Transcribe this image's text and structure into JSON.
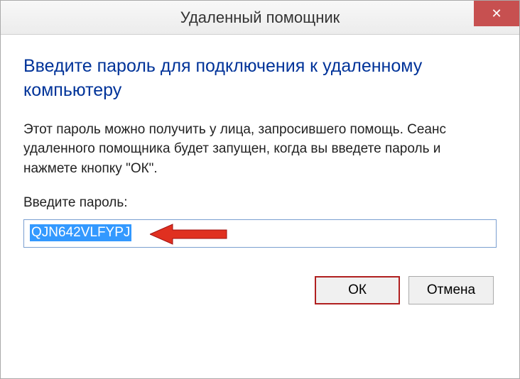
{
  "titlebar": {
    "title": "Удаленный помощник",
    "close_icon": "✕"
  },
  "dialog": {
    "heading": "Введите пароль для подключения к удаленному компьютеру",
    "body": "Этот пароль можно получить у лица, запросившего помощь. Сеанс удаленного помощника будет запущен, когда вы введете пароль и нажмете кнопку \"ОК\".",
    "field_label": "Введите пароль:",
    "password_value": "QJN642VLFYPJ"
  },
  "buttons": {
    "ok": "ОК",
    "cancel": "Отмена"
  },
  "annotation": {
    "arrow_color": "#e03020"
  }
}
